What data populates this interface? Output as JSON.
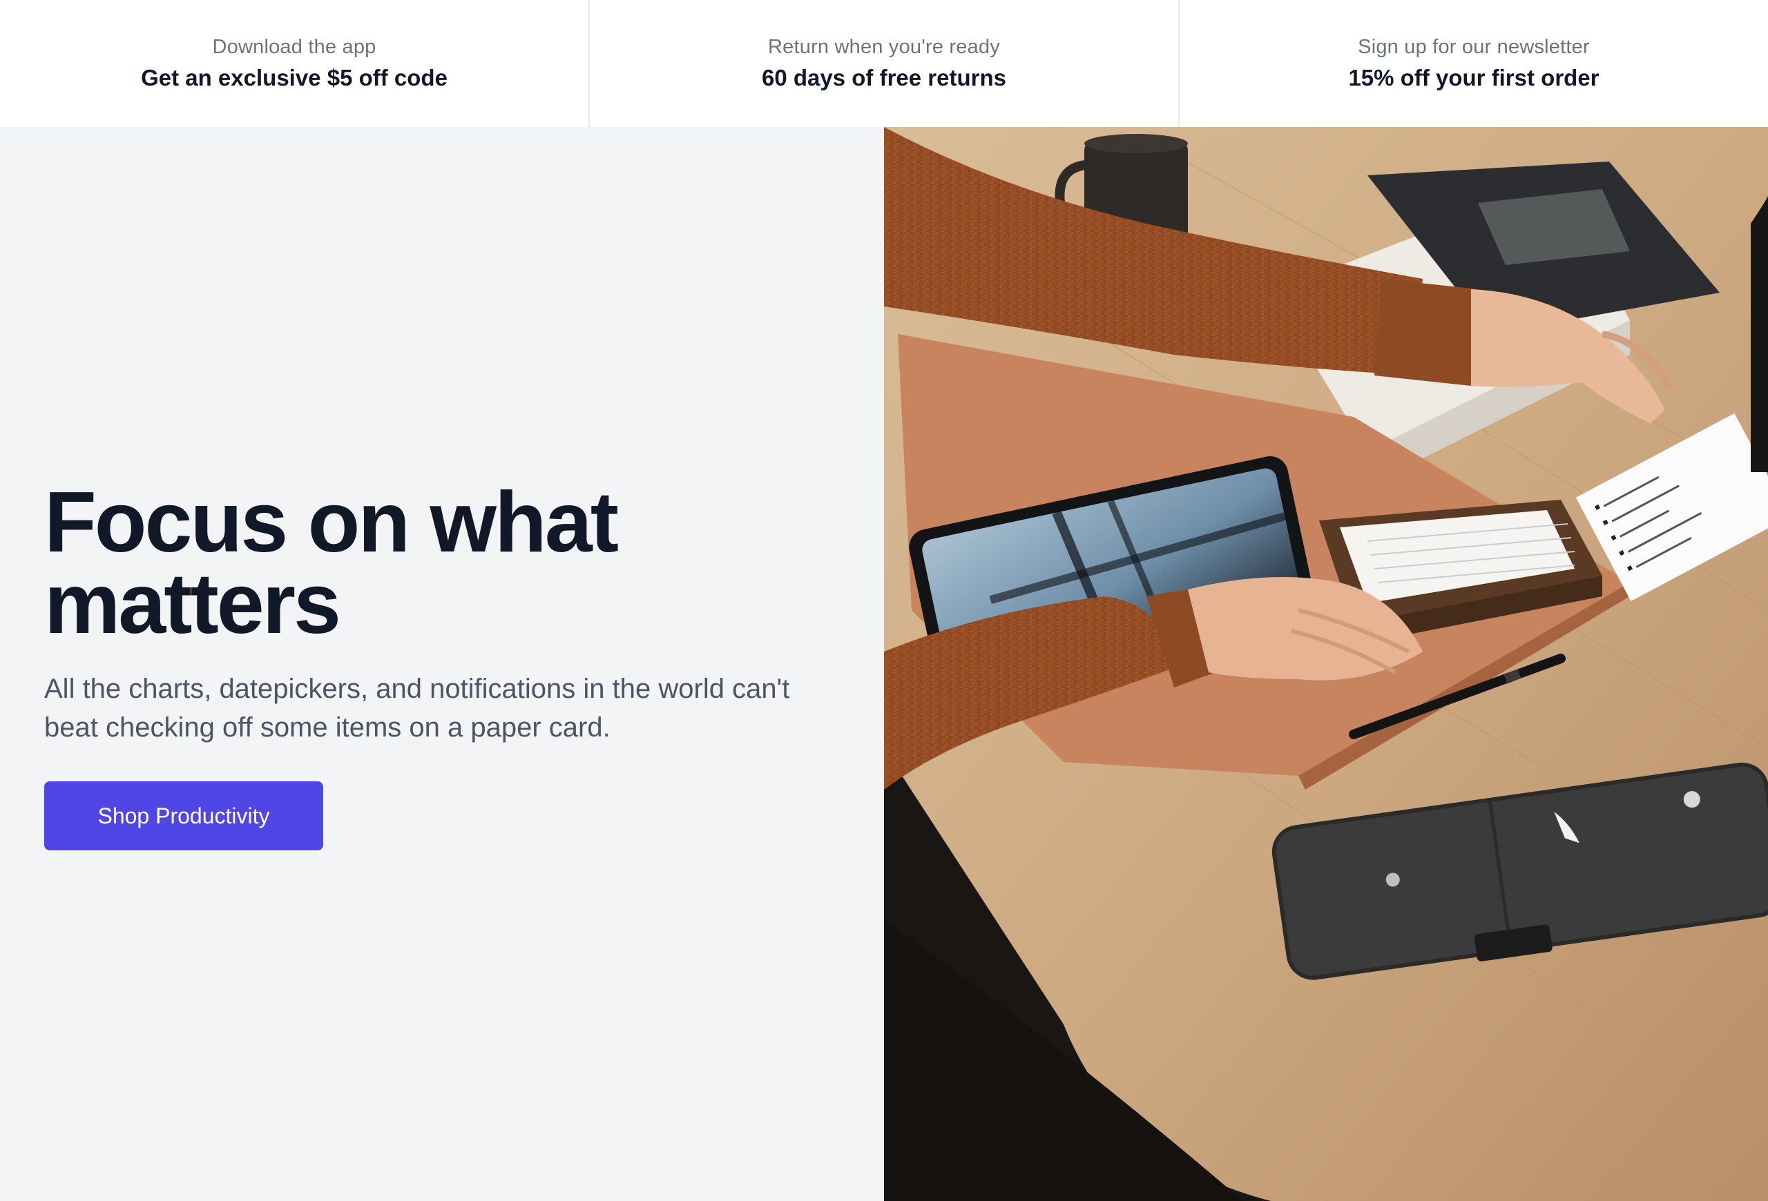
{
  "incentives": [
    {
      "kicker": "Download the app",
      "headline": "Get an exclusive $5 off code"
    },
    {
      "kicker": "Return when you're ready",
      "headline": "60 days of free returns"
    },
    {
      "kicker": "Sign up for our newsletter",
      "headline": "15% off your first order"
    }
  ],
  "hero": {
    "title": "Focus on what matters",
    "subtitle": "All the charts, datepickers, and notifications in the world can't beat checking off some items on a paper card.",
    "cta_label": "Shop Productivity",
    "image_subject": "desk-workspace-photo"
  },
  "colors": {
    "accent": "#4f46e5",
    "hero_bg": "#f3f4f6",
    "title_text": "#111827",
    "muted_text": "#6b7280"
  }
}
